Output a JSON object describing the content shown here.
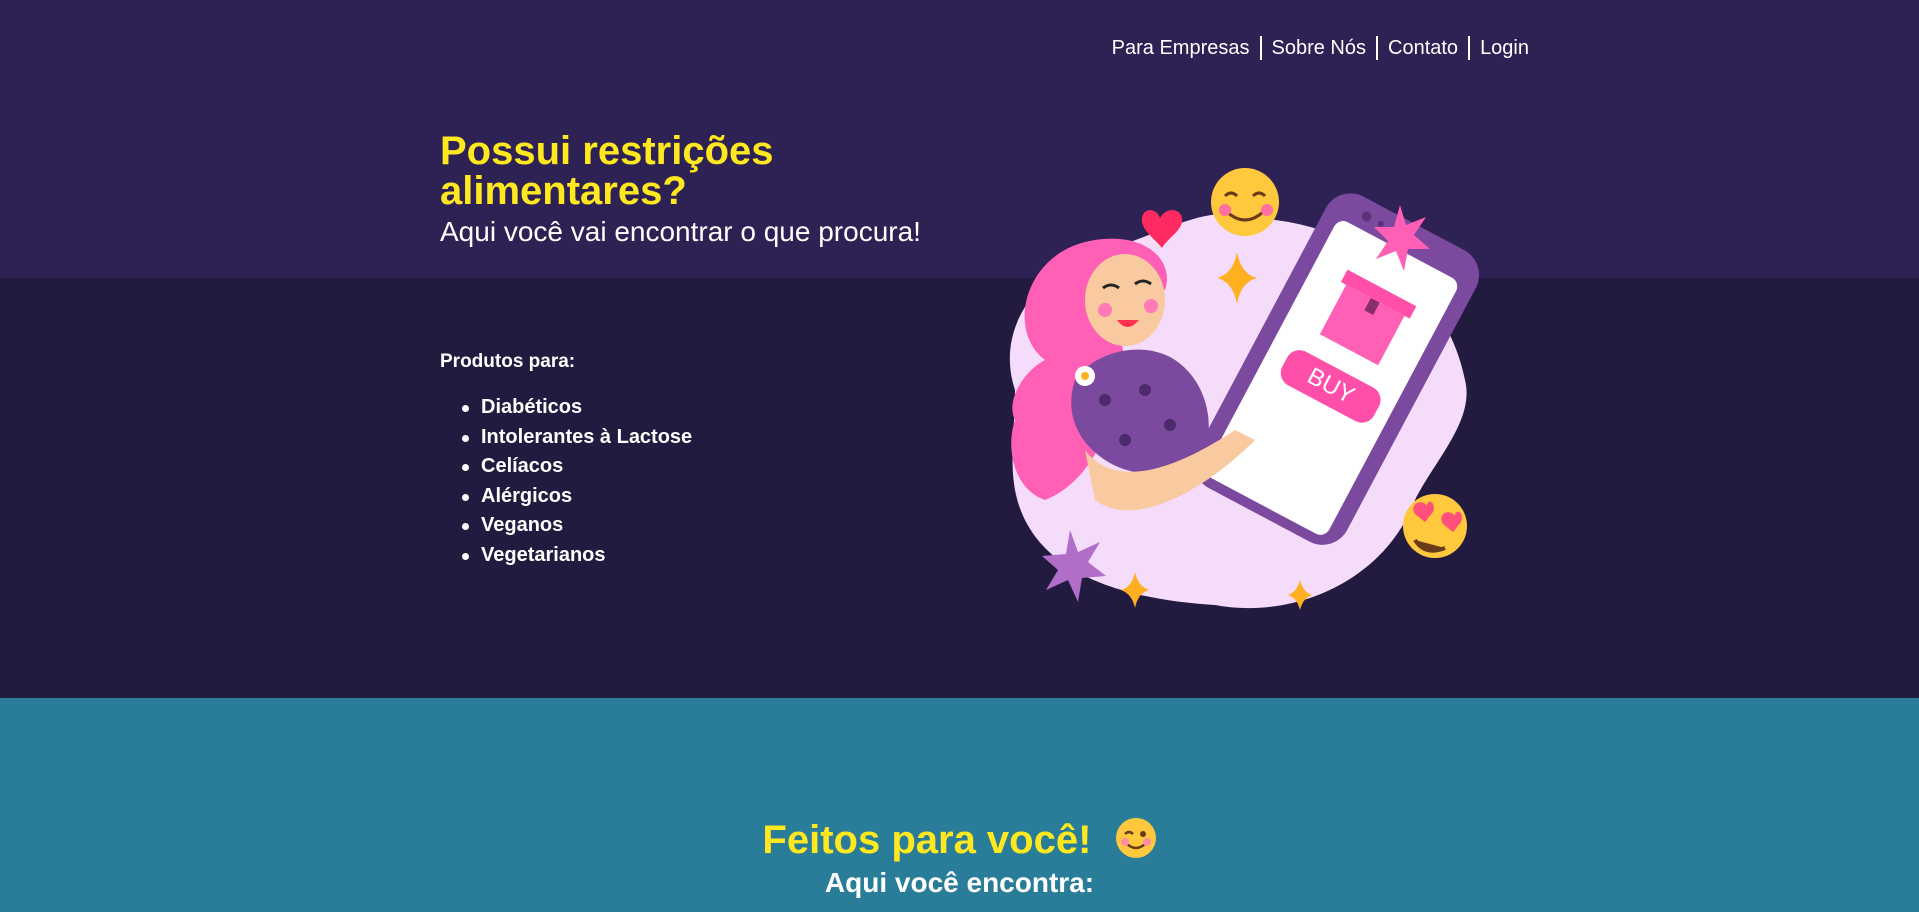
{
  "nav": {
    "items": [
      {
        "label": "Para Empresas"
      },
      {
        "label": "Sobre Nós"
      },
      {
        "label": "Contato"
      },
      {
        "label": "Login"
      }
    ]
  },
  "hero": {
    "title": "Possui restrições alimentares?",
    "subtitle": "Aqui você vai encontrar o que procura!",
    "illustration_button_text": "BUY"
  },
  "products": {
    "label": "Produtos para:",
    "items": [
      "Diabéticos",
      "Intolerantes à Lactose",
      "Celíacos",
      "Alérgicos",
      "Veganos",
      "Vegetarianos"
    ]
  },
  "section2": {
    "title": "Feitos para você!",
    "subtitle": "Aqui você encontra:"
  },
  "colors": {
    "header_bg": "#2e2153",
    "body_bg": "#231a40",
    "section2_bg": "#2a7d98",
    "accent_yellow": "#ffe81f",
    "text_white": "#ffffff",
    "pink": "#ff5fb5",
    "purple": "#7b4a9e"
  }
}
